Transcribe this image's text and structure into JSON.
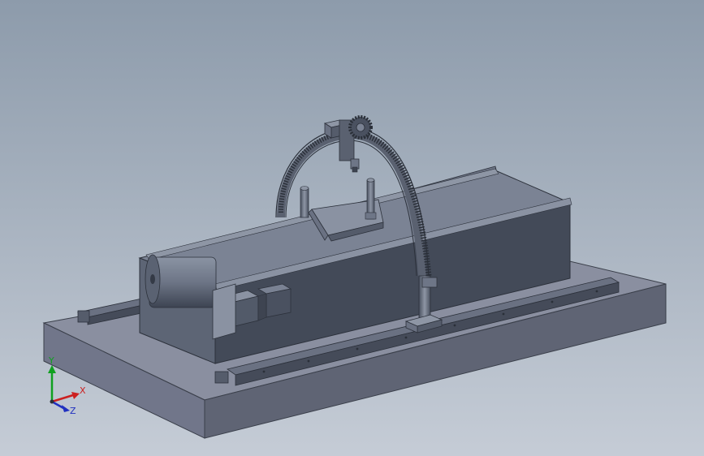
{
  "viewport": {
    "background_top": "#8d9bab",
    "background_bottom": "#c5ccd6"
  },
  "model": {
    "body_dark": "#434a58",
    "body_mid": "#5d6575",
    "body_light": "#7b8394",
    "base_top": "#8a8fa0",
    "base_front": "#5f6474",
    "base_side": "#71768a"
  },
  "triad": {
    "x_label": "X",
    "y_label": "Y",
    "z_label": "Z",
    "x_color": "#cc2020",
    "y_color": "#10a020",
    "z_color": "#2030c0"
  }
}
